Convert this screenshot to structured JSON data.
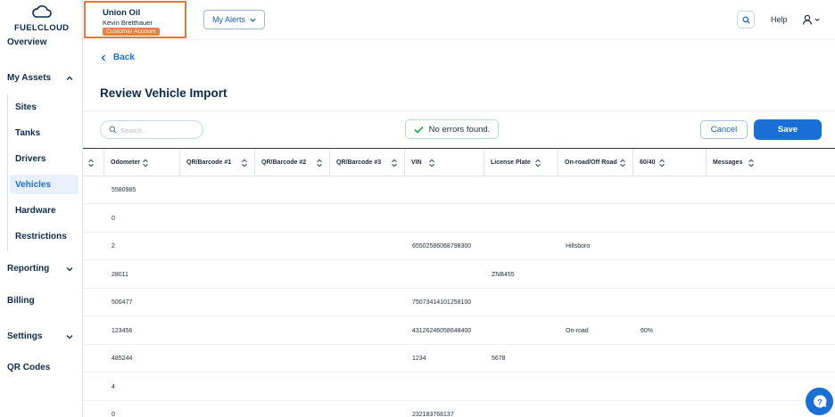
{
  "brand": {
    "name": "FUELCLOUD",
    "logo_icon": "cloud-icon"
  },
  "sidebar": {
    "items": [
      {
        "label": "Overview"
      },
      {
        "label": "My Assets",
        "expanded": true
      },
      {
        "label": "Reporting"
      },
      {
        "label": "Billing"
      },
      {
        "label": "Settings"
      },
      {
        "label": "QR Codes"
      }
    ],
    "sub_items": [
      {
        "label": "Sites"
      },
      {
        "label": "Tanks"
      },
      {
        "label": "Drivers"
      },
      {
        "label": "Vehicles",
        "active": true
      },
      {
        "label": "Hardware"
      },
      {
        "label": "Restrictions"
      }
    ]
  },
  "header": {
    "account": {
      "company": "Union Oil",
      "user": "Kevin Bretthauer",
      "badge": "Customer Account"
    },
    "alerts_label": "My Alerts",
    "help_label": "Help"
  },
  "page": {
    "back_label": "Back",
    "title": "Review Vehicle Import",
    "search_placeholder": "Search...",
    "status_text": "No errors found.",
    "cancel_label": "Cancel",
    "save_label": "Save"
  },
  "table": {
    "columns": [
      {
        "label": ""
      },
      {
        "label": "Odometer"
      },
      {
        "label": "QR/Barcode #1"
      },
      {
        "label": "QR/Barcode #2"
      },
      {
        "label": "QR/Barcode #3"
      },
      {
        "label": "VIN"
      },
      {
        "label": "License Plate"
      },
      {
        "label": "On-road/Off Road"
      },
      {
        "label": "60/40"
      },
      {
        "label": "Messages"
      }
    ],
    "rows": [
      [
        "",
        "5580985",
        "",
        "",
        "",
        "",
        "",
        "",
        "",
        ""
      ],
      [
        "",
        "0",
        "",
        "",
        "",
        "",
        "",
        "",
        "",
        ""
      ],
      [
        "",
        "2",
        "",
        "",
        "",
        "65502586068798300",
        "",
        "Hillsboro",
        "",
        ""
      ],
      [
        "",
        "28011",
        "",
        "",
        "",
        "",
        "ZNB455",
        "",
        "",
        ""
      ],
      [
        "",
        "500477",
        "",
        "",
        "",
        "75073414101258100",
        "",
        "",
        "",
        ""
      ],
      [
        "",
        "123456",
        "",
        "",
        "",
        "43126246058648400",
        "",
        "On-road",
        "60%",
        ""
      ],
      [
        "",
        "485244",
        "",
        "",
        "",
        "1234",
        "5678",
        "",
        "",
        ""
      ],
      [
        "",
        "4",
        "",
        "",
        "",
        "",
        "",
        "",
        "",
        ""
      ],
      [
        "",
        "0",
        "",
        "",
        "",
        "232183768137",
        "",
        "",
        "",
        ""
      ]
    ]
  },
  "colors": {
    "accent": "#1a6fd6",
    "badge": "#ec7c49",
    "highlight_border": "#e9743d",
    "success": "#2ea45a"
  }
}
